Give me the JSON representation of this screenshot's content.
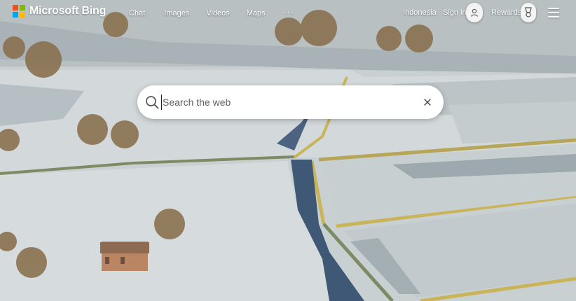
{
  "brand": {
    "name": "Microsoft Bing",
    "colors": {
      "square_red": "#f25022",
      "square_green": "#7fba00",
      "square_blue": "#00a4ef",
      "square_yellow": "#ffb900"
    }
  },
  "nav": {
    "items": [
      {
        "label": "Chat"
      },
      {
        "label": "Images"
      },
      {
        "label": "Videos"
      },
      {
        "label": "Maps"
      }
    ],
    "more_label": "···"
  },
  "header_right": {
    "region": "Indonesia",
    "sign_in": "Sign in",
    "rewards": "Rewards",
    "icons": [
      "user-icon",
      "rewards-trophy-icon",
      "menu-icon"
    ]
  },
  "search": {
    "placeholder": "Search the web",
    "value": "",
    "icons": [
      "search-icon",
      "clear-icon"
    ]
  },
  "background": {
    "description_colors": {
      "frost": "#d9dfe0",
      "shadow": "#5c6f84",
      "field": "#c6cfd0",
      "wall": "#c9b45a"
    }
  }
}
